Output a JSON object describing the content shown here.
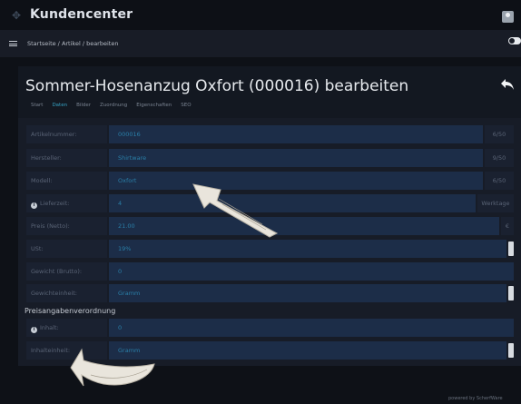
{
  "header": {
    "app_title": "Kundencenter"
  },
  "nav": {
    "breadcrumb": "Startseite / Artikel / bearbeiten"
  },
  "page": {
    "title": "Sommer-Hosenanzug Oxfort (000016) bearbeiten",
    "tabs": [
      {
        "label": "Start",
        "active": false
      },
      {
        "label": "Daten",
        "active": true
      },
      {
        "label": "Bilder",
        "active": false
      },
      {
        "label": "Zuordnung",
        "active": false
      },
      {
        "label": "Eigenschaften",
        "active": false
      },
      {
        "label": "SEO",
        "active": false
      }
    ]
  },
  "form": {
    "artikelnummer": {
      "label": "Artikelnummer:",
      "value": "000016",
      "counter": "6/50"
    },
    "hersteller": {
      "label": "Hersteller:",
      "value": "Shirtware",
      "counter": "9/50"
    },
    "modell": {
      "label": "Modell:",
      "value": "Oxfort",
      "counter": "6/50"
    },
    "lieferzeit": {
      "label": "Lieferzeit:",
      "value": "4",
      "suffix": "Werktage"
    },
    "preis": {
      "label": "Preis (Netto):",
      "value": "21.00",
      "suffix": "€"
    },
    "ust": {
      "label": "USt:",
      "value": "19%"
    },
    "gewicht": {
      "label": "Gewicht (Brutto):",
      "value": "0"
    },
    "gewichteinheit": {
      "label": "Gewichteinheit:",
      "value": "Gramm"
    },
    "section_preisangaben": "Preisangabenverordnung",
    "inhalt": {
      "label": "Inhalt:",
      "value": "0"
    },
    "inhalteinheit": {
      "label": "Inhalteinheit:",
      "value": "Gramm"
    }
  },
  "footer": {
    "text": "powered by ScherfWare"
  },
  "colors": {
    "accent": "#35a3c5",
    "input_bg": "#1c2d48",
    "label_bg": "#1a2130"
  },
  "icons": {
    "logo": "gear-icon",
    "user": "user-icon",
    "menu": "hamburger-icon",
    "back": "back-arrow-icon",
    "info": "info-icon"
  }
}
